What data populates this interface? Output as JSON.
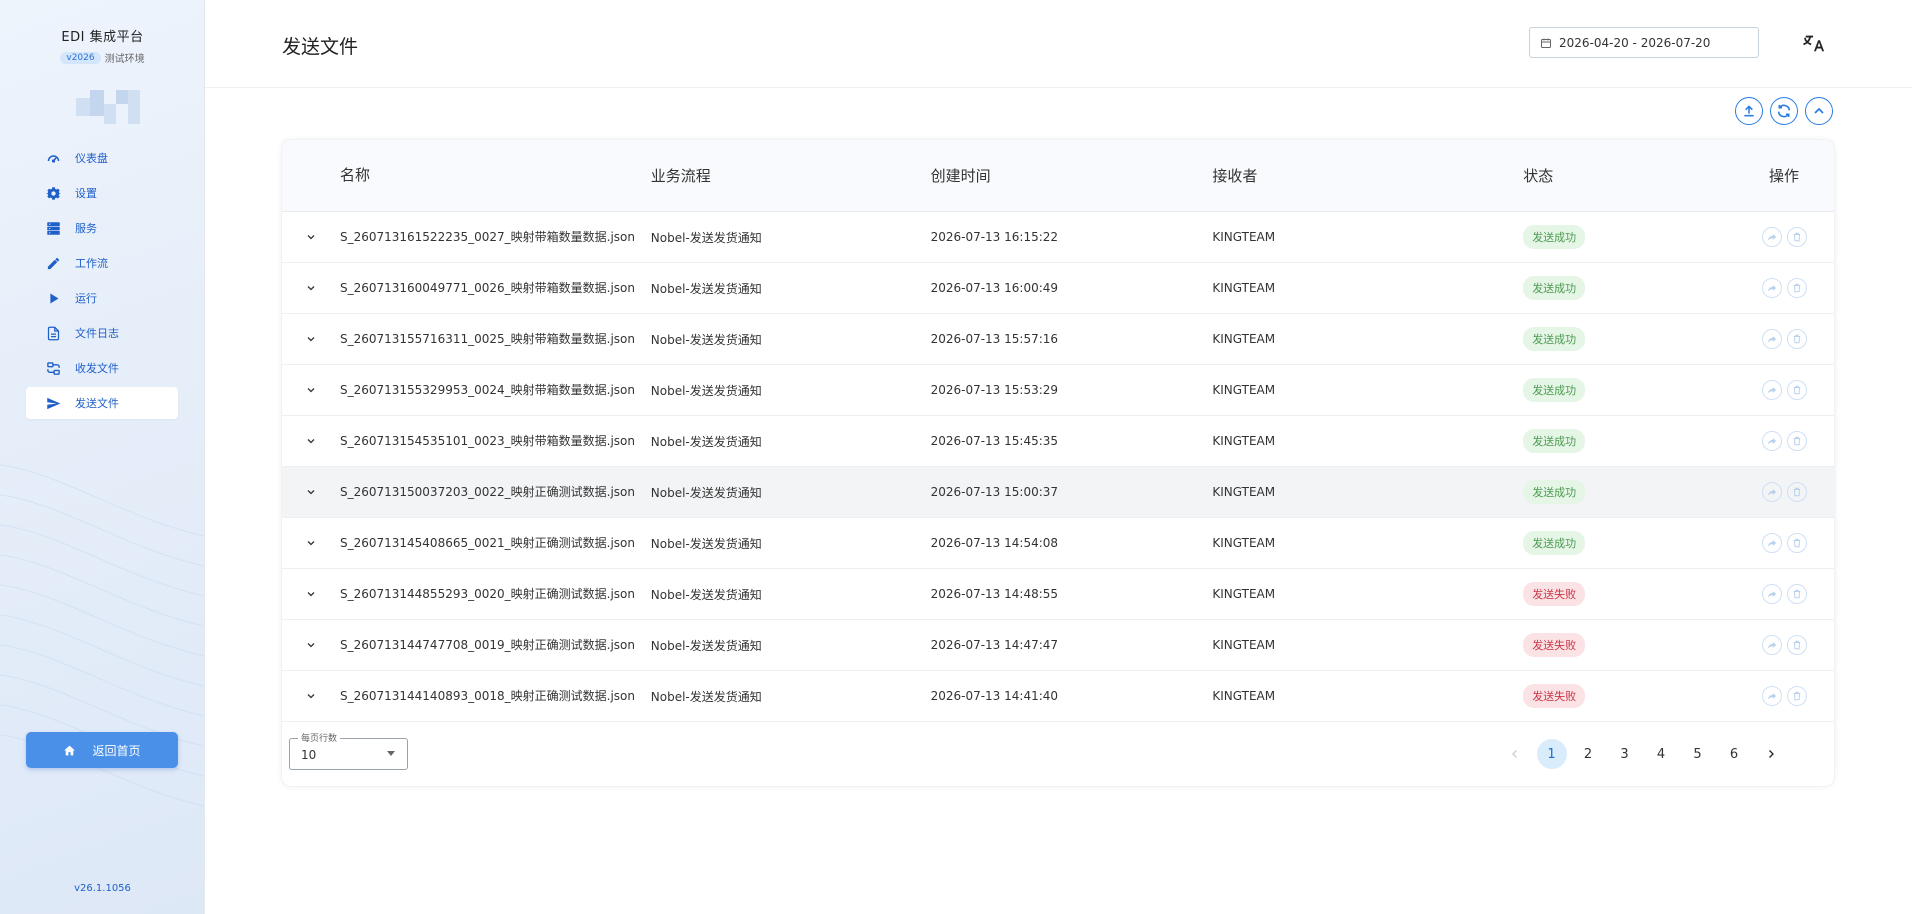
{
  "sidebar": {
    "brand_title": "EDI 集成平台",
    "version_badge": "v2026",
    "env_label": "测试环境",
    "items": [
      {
        "label": "仪表盘",
        "icon": "speedometer-icon"
      },
      {
        "label": "设置",
        "icon": "gear-icon"
      },
      {
        "label": "服务",
        "icon": "server-icon"
      },
      {
        "label": "工作流",
        "icon": "pencil-icon"
      },
      {
        "label": "运行",
        "icon": "play-icon"
      },
      {
        "label": "文件日志",
        "icon": "file-text-icon"
      },
      {
        "label": "收发文件",
        "icon": "transfer-icon"
      },
      {
        "label": "发送文件",
        "icon": "send-icon"
      }
    ],
    "active_item": "发送文件",
    "home_label": "返回首页",
    "version": "v26.1.1056"
  },
  "header": {
    "title": "发送文件",
    "date_range": "2026-04-20 - 2026-07-20"
  },
  "table": {
    "columns": [
      "名称",
      "业务流程",
      "创建时间",
      "接收者",
      "状态",
      "操作"
    ],
    "rows": [
      {
        "name": "S_260713161522235_0027_映射带箱数量数据.json",
        "flow": "Nobel-发送发货通知",
        "time": "2026-07-13 16:15:22",
        "receiver": "KINGTEAM",
        "status": "发送成功",
        "status_type": "ok"
      },
      {
        "name": "S_260713160049771_0026_映射带箱数量数据.json",
        "flow": "Nobel-发送发货通知",
        "time": "2026-07-13 16:00:49",
        "receiver": "KINGTEAM",
        "status": "发送成功",
        "status_type": "ok"
      },
      {
        "name": "S_260713155716311_0025_映射带箱数量数据.json",
        "flow": "Nobel-发送发货通知",
        "time": "2026-07-13 15:57:16",
        "receiver": "KINGTEAM",
        "status": "发送成功",
        "status_type": "ok"
      },
      {
        "name": "S_260713155329953_0024_映射带箱数量数据.json",
        "flow": "Nobel-发送发货通知",
        "time": "2026-07-13 15:53:29",
        "receiver": "KINGTEAM",
        "status": "发送成功",
        "status_type": "ok"
      },
      {
        "name": "S_260713154535101_0023_映射带箱数量数据.json",
        "flow": "Nobel-发送发货通知",
        "time": "2026-07-13 15:45:35",
        "receiver": "KINGTEAM",
        "status": "发送成功",
        "status_type": "ok"
      },
      {
        "name": "S_260713150037203_0022_映射正确测试数据.json",
        "flow": "Nobel-发送发货通知",
        "time": "2026-07-13 15:00:37",
        "receiver": "KINGTEAM",
        "status": "发送成功",
        "status_type": "ok"
      },
      {
        "name": "S_260713145408665_0021_映射正确测试数据.json",
        "flow": "Nobel-发送发货通知",
        "time": "2026-07-13 14:54:08",
        "receiver": "KINGTEAM",
        "status": "发送成功",
        "status_type": "ok"
      },
      {
        "name": "S_260713144855293_0020_映射正确测试数据.json",
        "flow": "Nobel-发送发货通知",
        "time": "2026-07-13 14:48:55",
        "receiver": "KINGTEAM",
        "status": "发送失败",
        "status_type": "fail"
      },
      {
        "name": "S_260713144747708_0019_映射正确测试数据.json",
        "flow": "Nobel-发送发货通知",
        "time": "2026-07-13 14:47:47",
        "receiver": "KINGTEAM",
        "status": "发送失败",
        "status_type": "fail"
      },
      {
        "name": "S_260713144140893_0018_映射正确测试数据.json",
        "flow": "Nobel-发送发货通知",
        "time": "2026-07-13 14:41:40",
        "receiver": "KINGTEAM",
        "status": "发送失败",
        "status_type": "fail"
      }
    ]
  },
  "footer": {
    "rows_per_page_label": "每页行数",
    "rows_per_page_value": "10",
    "pages": [
      "1",
      "2",
      "3",
      "4",
      "5",
      "6"
    ],
    "current_page": "1"
  },
  "colors": {
    "accent": "#2a7de1",
    "success_bg": "#e5f5e6",
    "success_text": "#4c9b52",
    "fail_bg": "#fbe3e5",
    "fail_text": "#c8374a"
  }
}
